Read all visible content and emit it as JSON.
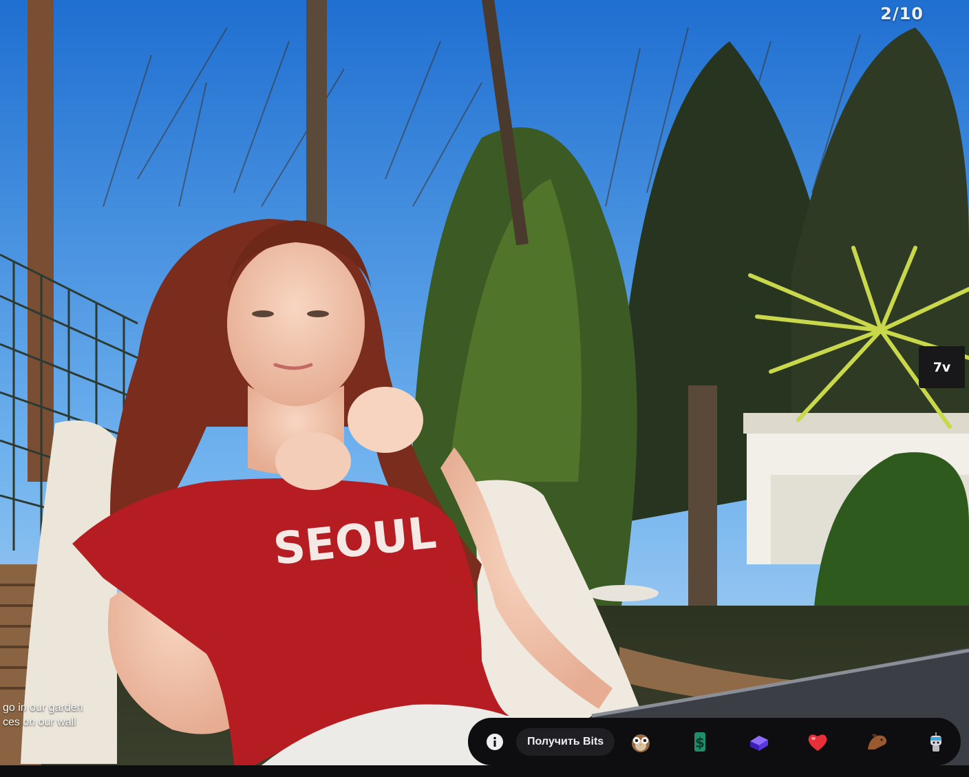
{
  "player": {
    "counter": "2/10",
    "extension_label": "7v"
  },
  "overlay": {
    "lines": [
      "go in our garden",
      "ces on our wall"
    ]
  },
  "bits_bar": {
    "get_bits_label": "Получить Bits",
    "emotes": [
      {
        "name": "owl-emote-icon"
      },
      {
        "name": "green-dollar-emote-icon"
      },
      {
        "name": "purple-cube-emote-icon"
      },
      {
        "name": "red-heart-emote-icon"
      },
      {
        "name": "horse-emote-icon"
      },
      {
        "name": "robot-emote-icon"
      }
    ]
  },
  "colors": {
    "bar_bg": "#0e0e10",
    "button_bg": "#1f1f23",
    "shirt_red": "#b51d22",
    "sky_blue": "#2f86e0"
  }
}
